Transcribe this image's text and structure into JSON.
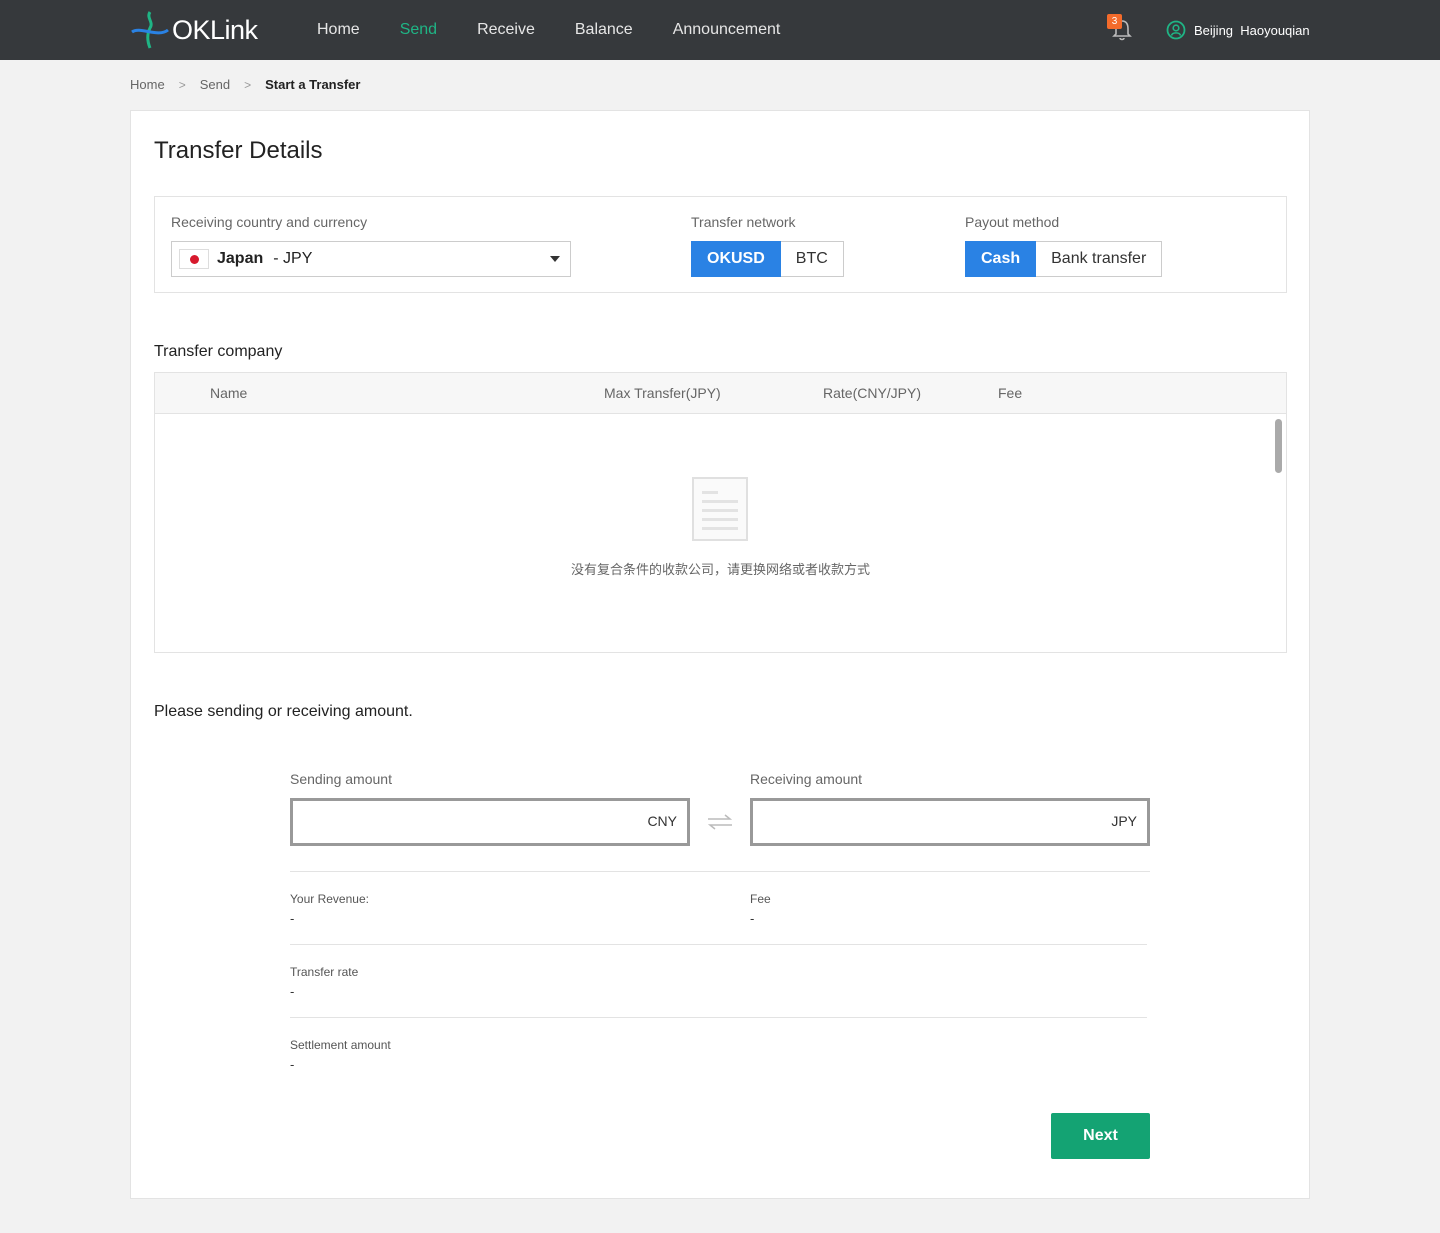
{
  "brand": {
    "name": "OKLink"
  },
  "nav": {
    "items": [
      {
        "label": "Home"
      },
      {
        "label": "Send"
      },
      {
        "label": "Receive"
      },
      {
        "label": "Balance"
      },
      {
        "label": "Announcement"
      }
    ],
    "active": "Send"
  },
  "notifications": {
    "count": "3",
    "icon": "bell-icon"
  },
  "user": {
    "name": "Beijing  Haoyouqian",
    "icon": "user-icon"
  },
  "breadcrumb": {
    "items": [
      "Home",
      "Send"
    ],
    "current": "Start a Transfer"
  },
  "page": {
    "title": "Transfer Details"
  },
  "settings": {
    "country_label": "Receiving country and currency",
    "country": "Japan",
    "currency": "- JPY",
    "network_label": "Transfer network",
    "networks": [
      "OKUSD",
      "BTC"
    ],
    "network_selected": "OKUSD",
    "payout_label": "Payout method",
    "payouts": [
      "Cash",
      "Bank transfer"
    ],
    "payout_selected": "Cash"
  },
  "company": {
    "title": "Transfer company",
    "columns": [
      "Name",
      "Max Transfer(JPY)",
      "Rate(CNY/JPY)",
      "Fee"
    ],
    "rows": [],
    "empty_text": "没有复合条件的收款公司，请更换网络或者收款方式"
  },
  "amount": {
    "title": "Please sending or receiving amount.",
    "sending_label": "Sending amount",
    "sending_value": "",
    "sending_currency": "CNY",
    "receiving_label": "Receiving amount",
    "receiving_value": "",
    "receiving_currency": "JPY",
    "revenue_label": "Your Revenue:",
    "revenue_value": "-",
    "fee_label": "Fee",
    "fee_value": "-",
    "rate_label": "Transfer rate",
    "rate_value": "-",
    "settlement_label": "Settlement amount",
    "settlement_value": "-"
  },
  "actions": {
    "next_label": "Next"
  },
  "colors": {
    "topbar": "#36393c",
    "active_nav": "#1fb585",
    "primary": "#2a82e4",
    "next": "#14a373",
    "badge": "#f46b2b"
  }
}
